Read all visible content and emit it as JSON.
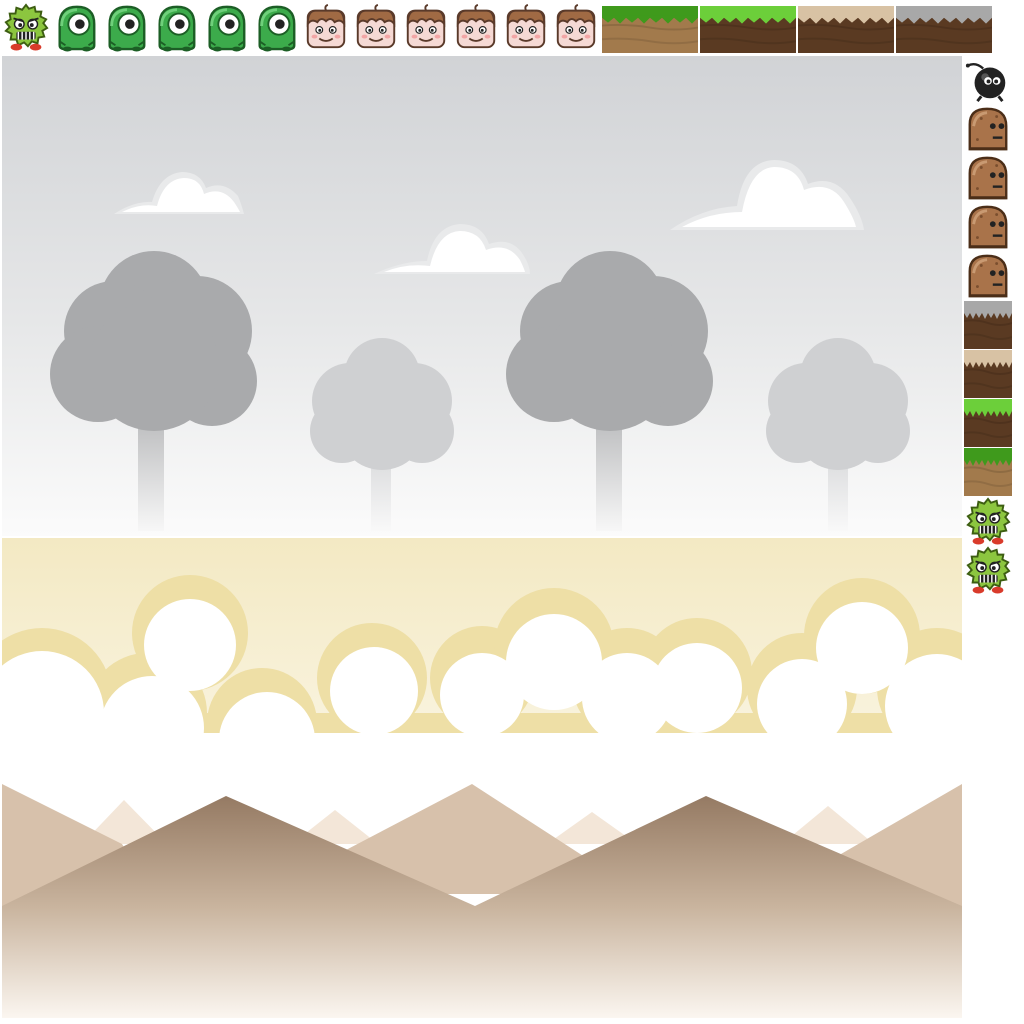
{
  "sheet": {
    "background_color": "#ffffff"
  },
  "top_row": {
    "sprites": [
      {
        "name": "spiky-green-monster-icon",
        "kind": "spiky"
      },
      {
        "name": "green-cyclops-icon",
        "kind": "cyclops"
      },
      {
        "name": "green-cyclops-icon",
        "kind": "cyclops"
      },
      {
        "name": "green-cyclops-icon",
        "kind": "cyclops"
      },
      {
        "name": "green-cyclops-icon",
        "kind": "cyclops"
      },
      {
        "name": "green-cyclops-icon",
        "kind": "cyclops"
      },
      {
        "name": "block-kid-face-icon",
        "kind": "kid"
      },
      {
        "name": "block-kid-face-icon",
        "kind": "kid"
      },
      {
        "name": "block-kid-face-icon",
        "kind": "kid"
      },
      {
        "name": "block-kid-face-icon",
        "kind": "kid"
      },
      {
        "name": "block-kid-face-icon",
        "kind": "kid"
      },
      {
        "name": "block-kid-face-icon",
        "kind": "kid"
      }
    ],
    "tiles": [
      {
        "name": "grass-dirt-tile",
        "top": "#3f9a1c",
        "body": "#a27a4c"
      },
      {
        "name": "grass-dark-dirt-tile",
        "top": "#6ccf3a",
        "body": "#5a3a22"
      },
      {
        "name": "sand-dirt-tile",
        "top": "#d8c2a4",
        "body": "#5a3a22"
      },
      {
        "name": "stone-dirt-tile",
        "top": "#a8a8a8",
        "body": "#5a3a22"
      }
    ]
  },
  "side_column": {
    "sprites": [
      {
        "name": "black-bomb-creature-icon",
        "kind": "bomb"
      },
      {
        "name": "brown-rock-creature-icon",
        "kind": "rock"
      },
      {
        "name": "brown-rock-creature-icon",
        "kind": "rock"
      },
      {
        "name": "brown-rock-creature-icon",
        "kind": "rock"
      },
      {
        "name": "brown-rock-creature-icon",
        "kind": "rock"
      },
      {
        "name": "stone-dirt-tile",
        "kind": "tile",
        "top": "#a8a8a8",
        "body": "#5a3a22"
      },
      {
        "name": "sand-dirt-tile",
        "kind": "tile",
        "top": "#d8c2a4",
        "body": "#5a3a22"
      },
      {
        "name": "grass-dark-dirt-tile",
        "kind": "tile",
        "top": "#6ccf3a",
        "body": "#5a3a22"
      },
      {
        "name": "grass-dirt-tile",
        "kind": "tile",
        "top": "#3f9a1c",
        "body": "#a27a4c"
      },
      {
        "name": "spiky-green-monster-icon",
        "kind": "spiky"
      },
      {
        "name": "spiky-green-monster-icon",
        "kind": "spiky"
      }
    ]
  },
  "backgrounds": {
    "forest": {
      "sky_top": "#d1d3d6",
      "sky_bottom": "#fafafa",
      "tree_dark": "#a9aaac",
      "tree_light": "#cfd0d2"
    },
    "clouds": {
      "sky_top": "#f3e9c3",
      "cloud_outline": "#eedfa6",
      "cloud_fill": "#ffffff"
    },
    "desert": {
      "far_peak": "#f3e6d8",
      "mid_peak": "#d7c1ab",
      "near_peak": "#957a63",
      "ground_bottom": "#fbf6f0"
    }
  }
}
